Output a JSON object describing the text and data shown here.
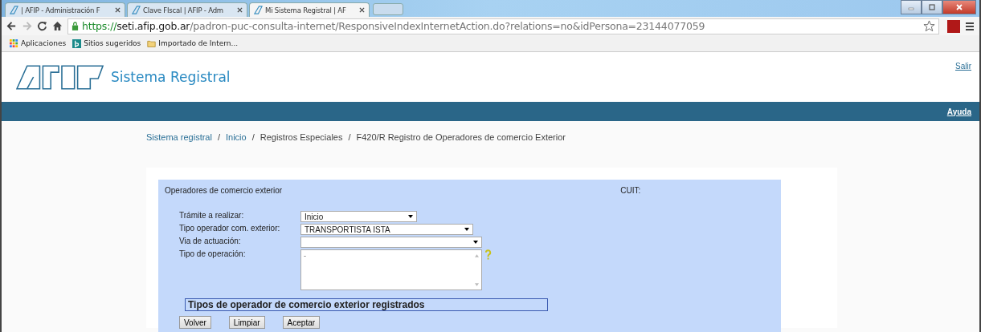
{
  "browser": {
    "tabs": [
      {
        "title": "| AFIP - Administración F",
        "selected": false
      },
      {
        "title": "Clave FIscal | AFIP - Adm",
        "selected": false
      },
      {
        "title": "Mi Sistema Registral | AF",
        "selected": true
      }
    ],
    "address": {
      "scheme": "https://",
      "host": "seti.afip.gob.ar",
      "path": "/padron-puc-consulta-internet/ResponsiveIndexInternetAction.do?relations=no&idPersona=23144077059"
    },
    "bookmarks": [
      {
        "kind": "apps",
        "label": "Aplicaciones"
      },
      {
        "kind": "site",
        "label": "Sitios sugeridos"
      },
      {
        "kind": "folder",
        "label": "Importado de Intern..."
      }
    ]
  },
  "header": {
    "app_title": "Sistema Registral",
    "logout": "Salir",
    "help": "Ayuda"
  },
  "breadcrumb": [
    {
      "label": "Sistema registral",
      "kind": "link"
    },
    {
      "separator": "/",
      "label": "Inicio",
      "kind": "link"
    },
    {
      "separator": "/",
      "label": "Registros Especiales",
      "kind": "text"
    },
    {
      "separator": "/",
      "label": "F420/R Registro de Operadores de comercio Exterior",
      "kind": "text"
    }
  ],
  "form": {
    "title": "Operadores de comercio exterior",
    "cuit_label": "CUIT:",
    "fields": [
      {
        "kind": "select",
        "label": "Trámite a realizar:",
        "value": "Inicio"
      },
      {
        "kind": "select",
        "label": "Tipo operador com. exterior:",
        "value": "TRANSPORTISTA ISTA"
      },
      {
        "kind": "select",
        "label": "Via de actuación:"
      },
      {
        "kind": "listbox",
        "label": "Tipo de operación:",
        "value": "-",
        "help": true
      }
    ],
    "section_heading": "Tipos de operador de comercio exterior registrados",
    "buttons": [
      "Volver",
      "Limpiar",
      "Aceptar"
    ]
  }
}
